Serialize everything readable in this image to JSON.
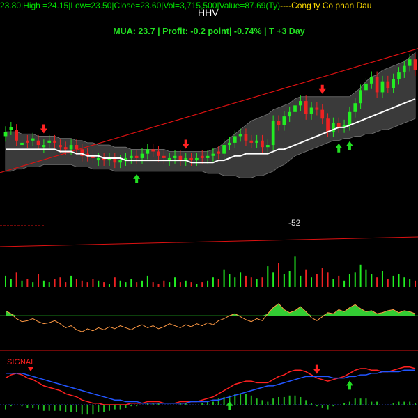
{
  "header": {
    "open": "23.80",
    "high": "High =24.15",
    "low": "Low=23.50",
    "close": "Close=23.60",
    "vol": "Vol=3,715,500",
    "value": "Value=87.69(Ty)",
    "company": "----Cong ty Co phan Dau",
    "ticker": "HHV"
  },
  "trade_line": "MUA:  23.7  |  Profit: -0.2 point|  -0.74%  |  T +3 Day",
  "labels": {
    "momentum_value": "-52",
    "signal": "SIGNAL"
  },
  "colors": {
    "up": "#22ee22",
    "down": "#ee2222",
    "ma": "#ffffff",
    "band_fill": "#3a3a3a",
    "trend": "#dd1111",
    "osc_line": "#ff9944",
    "osc_fill": "#33cc33",
    "signal_red": "#ff2020",
    "signal_blue": "#2255ff",
    "buy_arrow": "#22dd22",
    "sell_arrow": "#ff2222"
  },
  "chart_data": [
    {
      "type": "candlestick",
      "panel": "price",
      "title": "HHV",
      "x": [
        0,
        1,
        2,
        3,
        4,
        5,
        6,
        7,
        8,
        9,
        10,
        11,
        12,
        13,
        14,
        15,
        16,
        17,
        18,
        19,
        20,
        21,
        22,
        23,
        24,
        25,
        26,
        27,
        28,
        29,
        30,
        31,
        32,
        33,
        34,
        35,
        36,
        37,
        38,
        39,
        40,
        41,
        42,
        43,
        44,
        45,
        46,
        47,
        48,
        49,
        50,
        51,
        52,
        53,
        54,
        55,
        56,
        57,
        58,
        59,
        60,
        61,
        62,
        63,
        64,
        65,
        66,
        67,
        68,
        69,
        70,
        71,
        72,
        73,
        74,
        75
      ],
      "close": [
        22.4,
        22.6,
        22.0,
        21.9,
        21.9,
        22.1,
        21.8,
        21.8,
        22.0,
        21.9,
        21.7,
        21.6,
        21.8,
        21.6,
        21.3,
        21.3,
        21.2,
        21.2,
        21.1,
        21.2,
        21.0,
        21.1,
        21.2,
        21.3,
        21.2,
        21.4,
        21.6,
        21.5,
        21.3,
        21.2,
        21.2,
        21.3,
        21.1,
        21.2,
        21.1,
        21.2,
        21.2,
        21.3,
        21.4,
        21.4,
        21.8,
        21.9,
        22.2,
        22.3,
        22.0,
        21.9,
        22.0,
        21.7,
        21.8,
        22.9,
        22.7,
        23.1,
        23.3,
        23.6,
        23.8,
        23.2,
        23.5,
        23.4,
        23.0,
        22.4,
        22.8,
        22.6,
        22.7,
        23.3,
        23.7,
        24.3,
        24.6,
        24.9,
        24.2,
        24.7,
        24.4,
        24.8,
        25.1,
        25.4,
        25.7,
        25.2
      ],
      "open": [
        22.2,
        22.5,
        22.5,
        21.8,
        22.0,
        22.0,
        22.0,
        21.7,
        21.9,
        22.0,
        21.8,
        21.7,
        21.6,
        21.8,
        21.6,
        21.4,
        21.3,
        21.1,
        21.2,
        21.1,
        21.2,
        21.0,
        21.1,
        21.2,
        21.3,
        21.2,
        21.4,
        21.6,
        21.5,
        21.3,
        21.1,
        21.2,
        21.3,
        21.1,
        21.2,
        21.1,
        21.3,
        21.2,
        21.3,
        21.5,
        21.4,
        21.8,
        21.9,
        22.2,
        22.3,
        22.0,
        21.9,
        22.0,
        21.7,
        21.8,
        22.9,
        22.7,
        23.1,
        23.3,
        23.6,
        23.8,
        23.2,
        23.5,
        23.4,
        23.0,
        22.4,
        22.8,
        22.6,
        22.7,
        23.3,
        23.7,
        24.3,
        24.6,
        24.9,
        24.2,
        24.7,
        24.4,
        24.8,
        25.1,
        25.4,
        25.7
      ],
      "ma": [
        21.6,
        21.6,
        21.6,
        21.6,
        21.6,
        21.6,
        21.6,
        21.6,
        21.6,
        21.6,
        21.5,
        21.5,
        21.5,
        21.4,
        21.4,
        21.3,
        21.3,
        21.3,
        21.2,
        21.2,
        21.2,
        21.2,
        21.1,
        21.1,
        21.1,
        21.1,
        21.1,
        21.1,
        21.1,
        21.1,
        21.1,
        21.1,
        21.1,
        21.1,
        21.0,
        21.0,
        21.0,
        21.0,
        21.0,
        21.1,
        21.1,
        21.2,
        21.3,
        21.3,
        21.4,
        21.4,
        21.4,
        21.4,
        21.4,
        21.5,
        21.6,
        21.6,
        21.7,
        21.8,
        21.9,
        22.0,
        22.1,
        22.2,
        22.3,
        22.4,
        22.5,
        22.6,
        22.6,
        22.7,
        22.8,
        22.9,
        23.0,
        23.1,
        23.2,
        23.3,
        23.4,
        23.5,
        23.6,
        23.7,
        23.8,
        23.9
      ],
      "band_upper": [
        22.4,
        22.4,
        22.4,
        22.3,
        22.3,
        22.3,
        22.2,
        22.2,
        22.2,
        22.2,
        22.1,
        22.1,
        22.1,
        22.0,
        22.0,
        21.9,
        21.9,
        21.8,
        21.8,
        21.8,
        21.7,
        21.7,
        21.7,
        21.6,
        21.6,
        21.6,
        21.6,
        21.6,
        21.6,
        21.6,
        21.5,
        21.5,
        21.5,
        21.5,
        21.5,
        21.5,
        21.5,
        21.5,
        21.6,
        21.7,
        21.9,
        22.1,
        22.3,
        22.5,
        22.7,
        22.9,
        23.0,
        23.1,
        23.2,
        23.4,
        23.5,
        23.6,
        23.7,
        23.9,
        24.0,
        24.0,
        24.0,
        24.0,
        24.0,
        24.0,
        24.0,
        24.0,
        24.0,
        24.0,
        24.2,
        24.4,
        24.7,
        24.9,
        25.0,
        25.2,
        25.3,
        25.4,
        25.5,
        25.6,
        25.8,
        26.0
      ],
      "band_lower": [
        20.6,
        20.6,
        20.7,
        20.7,
        20.8,
        20.8,
        20.8,
        20.9,
        20.9,
        20.9,
        20.9,
        20.9,
        20.9,
        20.8,
        20.8,
        20.8,
        20.7,
        20.7,
        20.7,
        20.7,
        20.6,
        20.6,
        20.6,
        20.6,
        20.6,
        20.6,
        20.6,
        20.6,
        20.6,
        20.6,
        20.6,
        20.6,
        20.6,
        20.6,
        20.6,
        20.6,
        20.6,
        20.5,
        20.5,
        20.5,
        20.4,
        20.4,
        20.4,
        20.3,
        20.3,
        20.3,
        20.4,
        20.4,
        20.5,
        20.6,
        20.8,
        20.9,
        21.1,
        21.3,
        21.4,
        21.5,
        21.6,
        21.7,
        21.8,
        21.9,
        22.0,
        22.0,
        22.1,
        22.1,
        22.2,
        22.2,
        22.3,
        22.3,
        22.4,
        22.5,
        22.5,
        22.6,
        22.7,
        22.8,
        22.9,
        23.0
      ],
      "ylim": [
        18.5,
        26.5
      ],
      "buy_signals": [
        24,
        61,
        63
      ],
      "sell_signals": [
        7,
        33,
        58
      ]
    },
    {
      "type": "bar",
      "panel": "volume",
      "x": [
        0,
        1,
        2,
        3,
        4,
        5,
        6,
        7,
        8,
        9,
        10,
        11,
        12,
        13,
        14,
        15,
        16,
        17,
        18,
        19,
        20,
        21,
        22,
        23,
        24,
        25,
        26,
        27,
        28,
        29,
        30,
        31,
        32,
        33,
        34,
        35,
        36,
        37,
        38,
        39,
        40,
        41,
        42,
        43,
        44,
        45,
        46,
        47,
        48,
        49,
        50,
        51,
        52,
        53,
        54,
        55,
        56,
        57,
        58,
        59,
        60,
        61,
        62,
        63,
        64,
        65,
        66,
        67,
        68,
        69,
        70,
        71,
        72,
        73,
        74,
        75
      ],
      "values": [
        0.7,
        0.5,
        0.9,
        0.4,
        0.5,
        0.3,
        0.8,
        0.4,
        0.3,
        0.5,
        0.6,
        0.3,
        0.7,
        0.5,
        0.4,
        0.3,
        0.5,
        0.4,
        0.3,
        0.2,
        0.6,
        0.4,
        0.3,
        0.5,
        0.3,
        0.4,
        0.7,
        0.3,
        0.2,
        0.4,
        0.3,
        0.6,
        0.3,
        0.4,
        0.3,
        0.2,
        0.3,
        0.4,
        0.6,
        0.5,
        1.1,
        0.8,
        0.6,
        0.9,
        0.7,
        0.6,
        0.5,
        0.6,
        1.3,
        0.9,
        1.5,
        0.8,
        1.0,
        1.9,
        0.7,
        1.1,
        0.6,
        0.8,
        1.2,
        0.9,
        0.5,
        0.7,
        0.4,
        0.8,
        0.9,
        1.4,
        1.1,
        0.8,
        0.6,
        1.0,
        0.5,
        0.7,
        0.8,
        0.6,
        0.5,
        0.4
      ],
      "ylim": [
        0,
        2.0
      ]
    },
    {
      "type": "area",
      "panel": "oscillator",
      "x": [
        0,
        1,
        2,
        3,
        4,
        5,
        6,
        7,
        8,
        9,
        10,
        11,
        12,
        13,
        14,
        15,
        16,
        17,
        18,
        19,
        20,
        21,
        22,
        23,
        24,
        25,
        26,
        27,
        28,
        29,
        30,
        31,
        32,
        33,
        34,
        35,
        36,
        37,
        38,
        39,
        40,
        41,
        42,
        43,
        44,
        45,
        46,
        47,
        48,
        49,
        50,
        51,
        52,
        53,
        54,
        55,
        56,
        57,
        58,
        59,
        60,
        61,
        62,
        63,
        64,
        65,
        66,
        67,
        68,
        69,
        70,
        71,
        72,
        73,
        74,
        75
      ],
      "values": [
        5,
        2,
        -3,
        -6,
        -5,
        -3,
        -6,
        -8,
        -7,
        -5,
        -8,
        -12,
        -10,
        -14,
        -16,
        -13,
        -15,
        -12,
        -14,
        -11,
        -13,
        -10,
        -12,
        -14,
        -11,
        -9,
        -12,
        -10,
        -13,
        -11,
        -8,
        -10,
        -12,
        -9,
        -11,
        -8,
        -10,
        -7,
        -9,
        -5,
        -3,
        0,
        2,
        -1,
        -4,
        -6,
        -3,
        -5,
        2,
        8,
        12,
        6,
        3,
        5,
        9,
        4,
        -2,
        -5,
        -1,
        3,
        2,
        6,
        4,
        8,
        11,
        7,
        4,
        5,
        2,
        3,
        5,
        6,
        3,
        5,
        4,
        2
      ],
      "ylim": [
        -20,
        16
      ]
    },
    {
      "type": "line",
      "panel": "signal",
      "title": "SIGNAL",
      "x": [
        0,
        1,
        2,
        3,
        4,
        5,
        6,
        7,
        8,
        9,
        10,
        11,
        12,
        13,
        14,
        15,
        16,
        17,
        18,
        19,
        20,
        21,
        22,
        23,
        24,
        25,
        26,
        27,
        28,
        29,
        30,
        31,
        32,
        33,
        34,
        35,
        36,
        37,
        38,
        39,
        40,
        41,
        42,
        43,
        44,
        45,
        46,
        47,
        48,
        49,
        50,
        51,
        52,
        53,
        54,
        55,
        56,
        57,
        58,
        59,
        60,
        61,
        62,
        63,
        64,
        65,
        66,
        67,
        68,
        69,
        70,
        71,
        72,
        73,
        74,
        75
      ],
      "series": [
        {
          "values": [
            0.6,
            0.8,
            0.9,
            0.8,
            0.6,
            0.5,
            0.3,
            0.1,
            0.0,
            -0.1,
            -0.2,
            -0.4,
            -0.5,
            -0.6,
            -0.8,
            -0.9,
            -1.0,
            -1.0,
            -1.1,
            -1.1,
            -1.1,
            -1.1,
            -1.1,
            -1.0,
            -1.0,
            -1.0,
            -0.9,
            -0.9,
            -0.9,
            -1.0,
            -1.0,
            -1.0,
            -0.9,
            -0.9,
            -0.9,
            -0.9,
            -0.8,
            -0.7,
            -0.6,
            -0.4,
            -0.2,
            0.0,
            0.2,
            0.3,
            0.4,
            0.4,
            0.3,
            0.3,
            0.3,
            0.5,
            0.7,
            0.8,
            1.0,
            1.1,
            1.1,
            1.0,
            0.8,
            0.6,
            0.5,
            0.4,
            0.5,
            0.6,
            0.7,
            0.9,
            1.1,
            1.2,
            1.2,
            1.1,
            1.1,
            1.0,
            1.0,
            1.1,
            1.2,
            1.3,
            1.3,
            1.2
          ]
        },
        {
          "values": [
            0.9,
            0.9,
            0.9,
            0.9,
            0.8,
            0.7,
            0.6,
            0.5,
            0.4,
            0.3,
            0.2,
            0.1,
            0.0,
            -0.1,
            -0.2,
            -0.3,
            -0.4,
            -0.5,
            -0.6,
            -0.7,
            -0.8,
            -0.8,
            -0.9,
            -0.9,
            -0.9,
            -1.0,
            -1.0,
            -1.0,
            -1.0,
            -1.0,
            -1.0,
            -1.0,
            -1.0,
            -1.0,
            -0.9,
            -0.9,
            -0.9,
            -0.9,
            -0.8,
            -0.8,
            -0.7,
            -0.6,
            -0.5,
            -0.4,
            -0.3,
            -0.2,
            -0.1,
            0.0,
            0.1,
            0.1,
            0.2,
            0.3,
            0.4,
            0.5,
            0.6,
            0.7,
            0.7,
            0.7,
            0.7,
            0.7,
            0.6,
            0.6,
            0.6,
            0.7,
            0.7,
            0.8,
            0.8,
            0.9,
            0.9,
            1.0,
            1.0,
            1.0,
            1.0,
            1.1,
            1.1,
            1.1
          ]
        }
      ],
      "ylim": [
        -1.5,
        1.6
      ],
      "buy_signals": [
        41,
        63
      ],
      "sell_signals": [
        57
      ]
    }
  ]
}
